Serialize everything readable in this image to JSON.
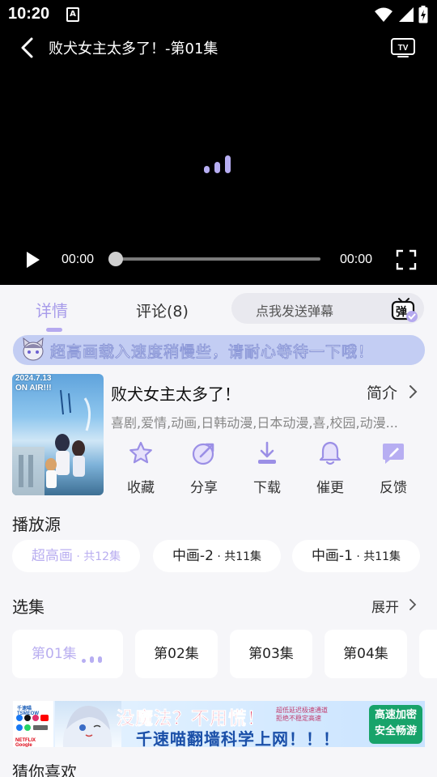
{
  "status_bar": {
    "time": "10:20",
    "a_badge": "A"
  },
  "player": {
    "title": "败犬女主太多了！-第01集",
    "current_time": "00:00",
    "total_time": "00:00",
    "progress": 0
  },
  "tabs": {
    "details": "详情",
    "comments": "评论(8)"
  },
  "danmaku": {
    "placeholder": "点我发送弹幕",
    "icon_char": "弹"
  },
  "notice": "超高画载入速度稍慢些，请耐心等待一下哦！",
  "info": {
    "poster_text": "2024.7.13\nON AIR!!!",
    "title": "败犬女主太多了！",
    "intro_label": "简介",
    "tags": "喜剧,爱情,动画,日韩动漫,日本动漫,喜,校园,动漫..."
  },
  "actions": [
    "收藏",
    "分享",
    "下载",
    "催更",
    "反馈"
  ],
  "sources": {
    "title": "播放源",
    "items": [
      {
        "name": "超高画",
        "count": " · 共12集",
        "active": true
      },
      {
        "name": "中画-2",
        "count": " · 共11集",
        "active": false
      },
      {
        "name": "中画-1",
        "count": " · 共11集",
        "active": false
      }
    ]
  },
  "episodes": {
    "title": "选集",
    "expand_label": "展开",
    "items": [
      "第01集",
      "第02集",
      "第03集",
      "第04集"
    ]
  },
  "ad": {
    "brand": "千速喵 TSMEOW",
    "logos": "NETFLIX Google",
    "headline": "没魔法？不用慌！",
    "subline": "千速喵翻墙科学上网！！！",
    "small": "超低延迟极速通道\n拒绝不稳定高速",
    "badge": "高速加密\n安全畅游"
  },
  "guess": {
    "title": "猜你喜欢"
  },
  "colors": {
    "accent": "#b5a9ef",
    "player_bg": "#000000",
    "page_bg": "#f6f6f9"
  }
}
